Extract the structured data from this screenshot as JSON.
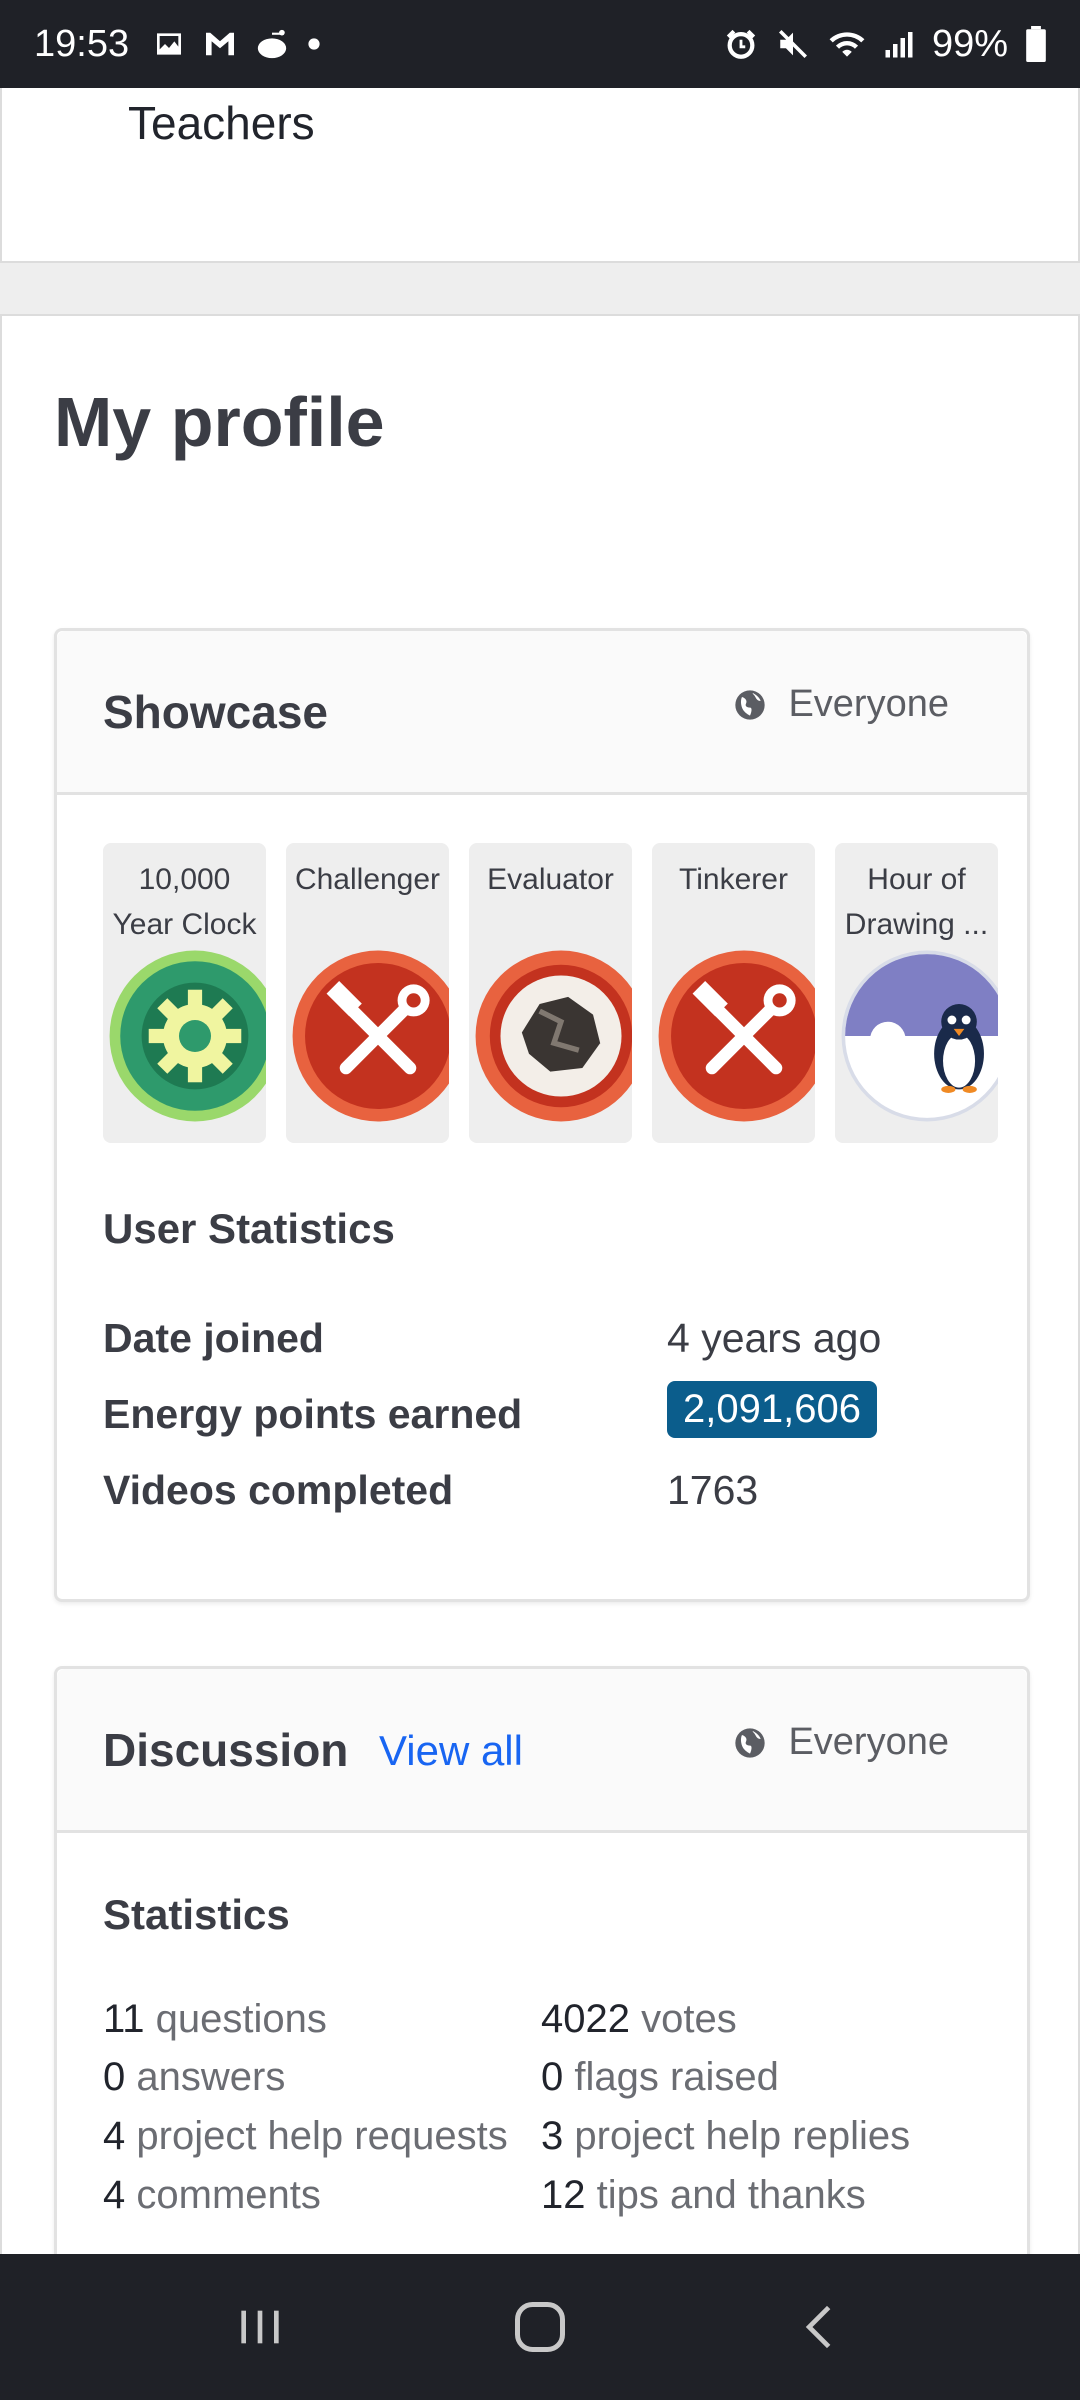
{
  "status_bar": {
    "time": "19:53",
    "battery": "99%",
    "left_icons": [
      "gallery-icon",
      "gmail-icon",
      "reddit-icon",
      "dot-icon"
    ],
    "right_icons": [
      "alarm-icon",
      "mute-icon",
      "wifi-icon",
      "signal-icon",
      "battery-icon"
    ]
  },
  "top_card": {
    "label": "Teachers"
  },
  "profile": {
    "title": "My profile",
    "showcase": {
      "title": "Showcase",
      "visibility": "Everyone",
      "badges": [
        {
          "label": "10,000 Year Clock",
          "icon": "gear-badge-icon",
          "color": "#2e9a6c"
        },
        {
          "label": "Challenger",
          "icon": "tools-badge-icon",
          "color": "#d0442b"
        },
        {
          "label": "Evaluator",
          "icon": "rock-badge-icon",
          "color": "#d0442b"
        },
        {
          "label": "Tinkerer",
          "icon": "tools-badge-icon",
          "color": "#d0442b"
        },
        {
          "label": "Hour of Drawing ...",
          "icon": "penguin-badge-icon",
          "color": "#7f7fc4"
        }
      ]
    },
    "user_statistics": {
      "title": "User Statistics",
      "rows": [
        {
          "key": "Date joined",
          "value": "4 years ago"
        },
        {
          "key": "Energy points earned",
          "value": "2,091,606"
        },
        {
          "key": "Videos completed",
          "value": "1763"
        }
      ]
    },
    "discussion": {
      "title": "Discussion",
      "view_all": "View all",
      "visibility": "Everyone",
      "stats_title": "Statistics",
      "stats_left": [
        {
          "count": "11",
          "label": "questions"
        },
        {
          "count": "0",
          "label": "answers"
        },
        {
          "count": "4",
          "label": "project help requests"
        },
        {
          "count": "4",
          "label": "comments"
        }
      ],
      "stats_right": [
        {
          "count": "4022",
          "label": "votes"
        },
        {
          "count": "0",
          "label": "flags raised"
        },
        {
          "count": "3",
          "label": "project help replies"
        },
        {
          "count": "12",
          "label": "tips and thanks"
        }
      ]
    }
  },
  "nav_bar": {
    "buttons": [
      "recents-icon",
      "home-icon",
      "back-icon"
    ]
  },
  "colors": {
    "accent": "#1865f2",
    "points_badge": "#0b5d8c",
    "system_bar": "#1f2127"
  }
}
